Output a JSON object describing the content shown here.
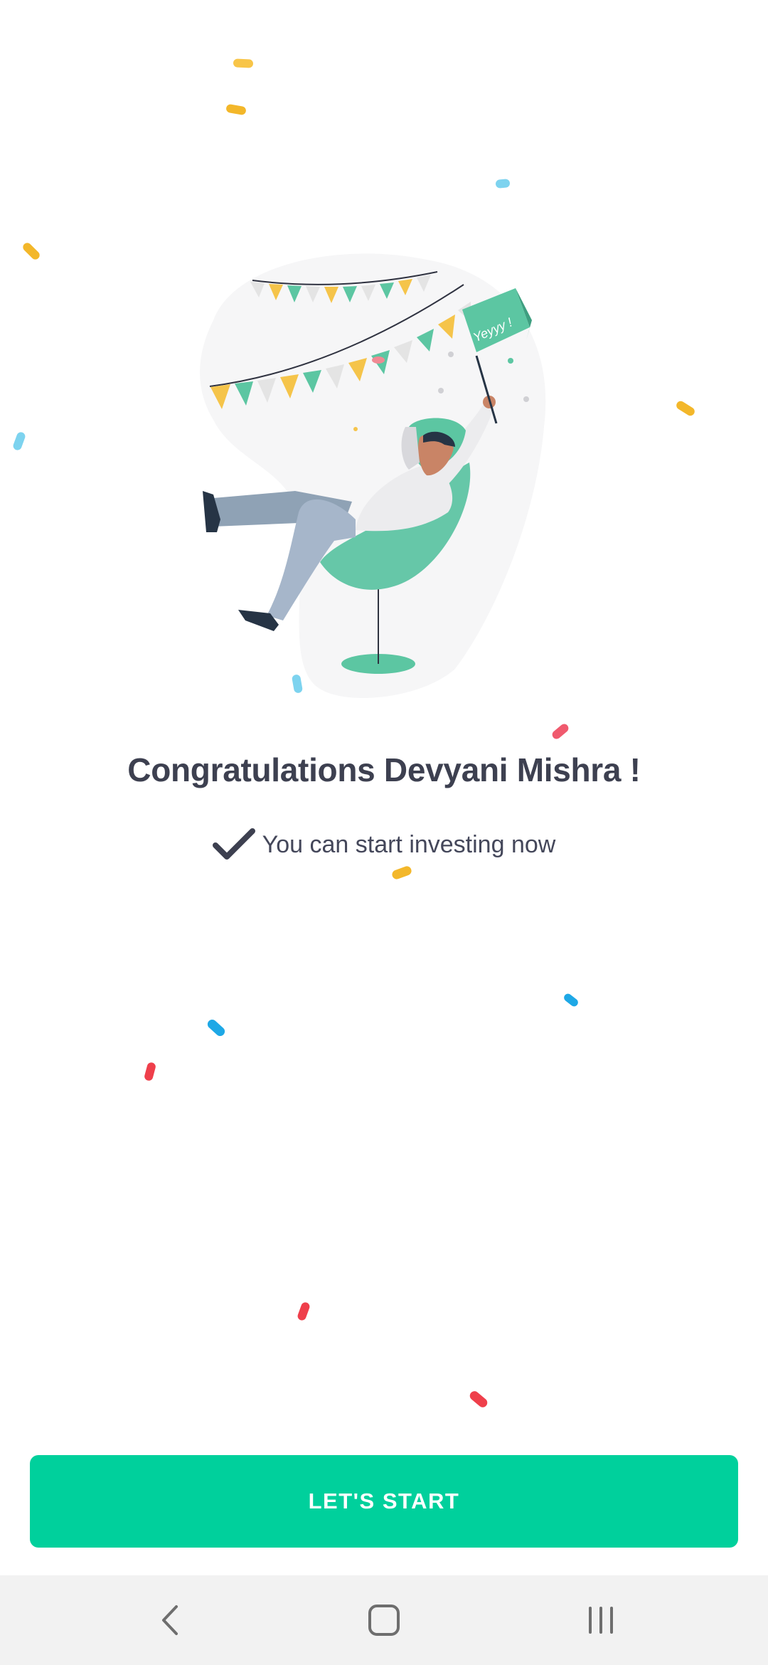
{
  "congrats": {
    "title": "Congratulations Devyani Mishra !",
    "subtitle": "You can start investing now"
  },
  "illustration": {
    "flag_text": "Yeyyy !"
  },
  "actions": {
    "start_label": "LET'S START"
  },
  "navbar": {
    "back_icon": "back-chevron",
    "home_icon": "home-square",
    "recents_icon": "recent-apps"
  },
  "colors": {
    "accent": "#00d09c",
    "text_primary": "#3d4050",
    "navbar_bg": "#f2f2f2"
  }
}
